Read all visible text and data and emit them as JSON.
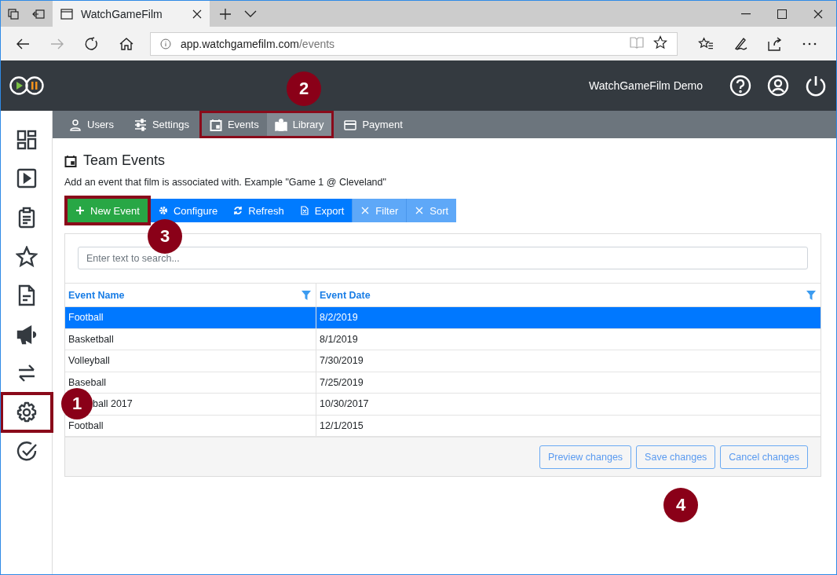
{
  "browser": {
    "tab_title": "WatchGameFilm",
    "url_host": "app.watchgamefilm.com",
    "url_path": "/events"
  },
  "header": {
    "user": "WatchGameFilm Demo"
  },
  "sidebar": {
    "items": [
      {
        "kind": "dashboard",
        "highlighted": false
      },
      {
        "kind": "play",
        "highlighted": false
      },
      {
        "kind": "clipboard",
        "highlighted": false
      },
      {
        "kind": "star",
        "highlighted": false
      },
      {
        "kind": "document",
        "highlighted": false
      },
      {
        "kind": "megaphone",
        "highlighted": false
      },
      {
        "kind": "swap",
        "highlighted": false
      },
      {
        "kind": "gear",
        "highlighted": true
      },
      {
        "kind": "check",
        "highlighted": false
      }
    ]
  },
  "subnav": {
    "callout": "2",
    "items": [
      {
        "kind": "users",
        "label": "Users",
        "selected": false,
        "highlighted": false
      },
      {
        "kind": "settings",
        "label": "Settings",
        "selected": false,
        "highlighted": false
      },
      {
        "kind": "events",
        "label": "Events",
        "selected": false,
        "highlighted": true
      },
      {
        "kind": "library",
        "label": "Library",
        "selected": true,
        "highlighted": true
      },
      {
        "kind": "payment",
        "label": "Payment",
        "selected": false,
        "highlighted": false
      }
    ]
  },
  "page": {
    "title": "Team Events",
    "description": "Add an event that film is associated with. Example \"Game 1 @ Cleveland\""
  },
  "toolbar": {
    "callout": "3",
    "buttons": [
      {
        "kind": "add",
        "label": "New Event",
        "disabled": false,
        "highlighted": true
      },
      {
        "kind": "configure",
        "label": "Configure",
        "disabled": false,
        "highlighted": false
      },
      {
        "kind": "refresh",
        "label": "Refresh",
        "disabled": false,
        "highlighted": false
      },
      {
        "kind": "export",
        "label": "Export",
        "disabled": false,
        "highlighted": false
      },
      {
        "kind": "clear",
        "label": "Filter",
        "disabled": true,
        "highlighted": false
      },
      {
        "kind": "clear",
        "label": "Sort",
        "disabled": true,
        "highlighted": false
      }
    ]
  },
  "search": {
    "placeholder": "Enter text to search..."
  },
  "table": {
    "columns": [
      "Event Name",
      "Event Date"
    ],
    "rows": [
      {
        "name": "Football",
        "date": "8/2/2019",
        "selected": true
      },
      {
        "name": "Basketball",
        "date": "8/1/2019",
        "selected": false
      },
      {
        "name": "Volleyball",
        "date": "7/30/2019",
        "selected": false
      },
      {
        "name": "Baseball",
        "date": "7/25/2019",
        "selected": false
      },
      {
        "name": "ball 2017",
        "date": "10/30/2017",
        "selected": false,
        "callout": "1"
      },
      {
        "name": "Football",
        "date": "12/1/2015",
        "selected": false
      }
    ]
  },
  "footer": {
    "buttons": [
      "Preview changes",
      "Save changes",
      "Cancel changes"
    ],
    "callout": "4"
  }
}
